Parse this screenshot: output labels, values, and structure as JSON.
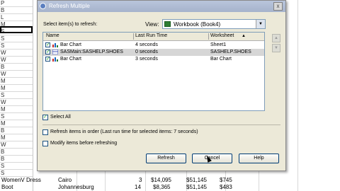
{
  "spreadsheet": {
    "col_a_letters": [
      "P",
      "B",
      "L",
      "M",
      "S",
      "S",
      "S",
      "W",
      "W",
      "B",
      "W",
      "M",
      "M",
      "S",
      "W",
      "M",
      "S",
      "M",
      "B",
      "M",
      "W",
      "B",
      "B",
      "S",
      "S"
    ],
    "bottom_rows": [
      {
        "a": "WomenV Dress",
        "b": "Cairo",
        "c": "3",
        "d": "$14,095",
        "e": "$51,145",
        "f": "$745"
      },
      {
        "a": "Boot",
        "b": "Johannesburg",
        "c": "14",
        "d": "$8,365",
        "e": "$51,145",
        "f": "$483"
      }
    ]
  },
  "dialog": {
    "title": "Refresh Multiple",
    "close_label": "x",
    "select_label": "Select item(s) to refresh:",
    "view_label": "View:",
    "view_value": "Workbook (Book4)",
    "columns": {
      "name": "Name",
      "last_run": "Last Run Time",
      "worksheet": "Worksheet"
    },
    "rows": [
      {
        "name": "Bar Chart",
        "last_run": "4 seconds",
        "worksheet": "Sheet1"
      },
      {
        "name": "SASMain:SASHELP.SHOES",
        "last_run": "0 seconds",
        "worksheet": "SASHELP.SHOES"
      },
      {
        "name": "Bar Chart",
        "last_run": "3 seconds",
        "worksheet": "Bar Chart"
      }
    ],
    "select_all_label": "Select All",
    "refresh_in_order_label": "Refresh items in order (Last run time for selected items: 7 seconds)",
    "modify_items_label": "Modify items before refreshing",
    "buttons": {
      "refresh": "Refresh",
      "cancel": "Cancel",
      "help": "Help"
    }
  }
}
